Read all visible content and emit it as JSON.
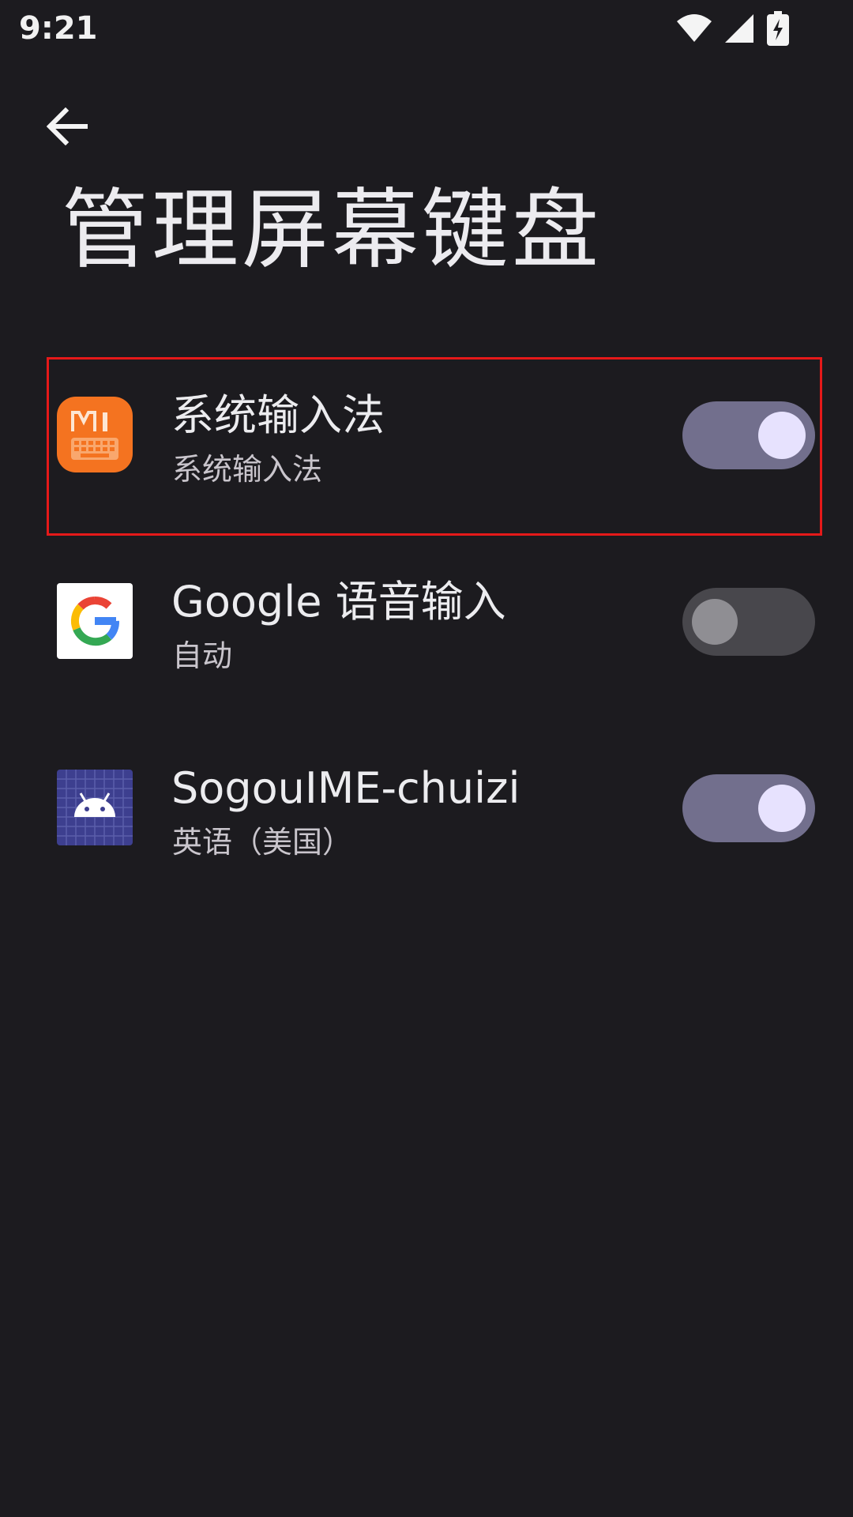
{
  "status_bar": {
    "time": "9:21",
    "icons": [
      "wifi-icon",
      "cell-signal-icon",
      "battery-charging-icon"
    ]
  },
  "header": {
    "back_icon": "arrow-left-icon",
    "title": "管理屏幕键盘"
  },
  "ime_items": [
    {
      "title": "系统输入法",
      "subtitle": "系统输入法",
      "icon": "mi-keyboard-icon",
      "enabled": true,
      "highlighted": true
    },
    {
      "title": "Google 语音输入",
      "subtitle": "自动",
      "icon": "google-g-icon",
      "enabled": false,
      "highlighted": false
    },
    {
      "title": "SogouIME-chuizi",
      "subtitle": "英语（美国）",
      "icon": "android-icon",
      "enabled": true,
      "highlighted": false
    }
  ],
  "colors": {
    "background": "#1c1b1f",
    "switch_track_on": "#726f8d",
    "switch_thumb_on": "#e7e2fe",
    "switch_track_off": "#48474c",
    "switch_thumb_off": "#8f8e93",
    "highlight_border": "#e51919",
    "mi_icon": "#f47320"
  }
}
